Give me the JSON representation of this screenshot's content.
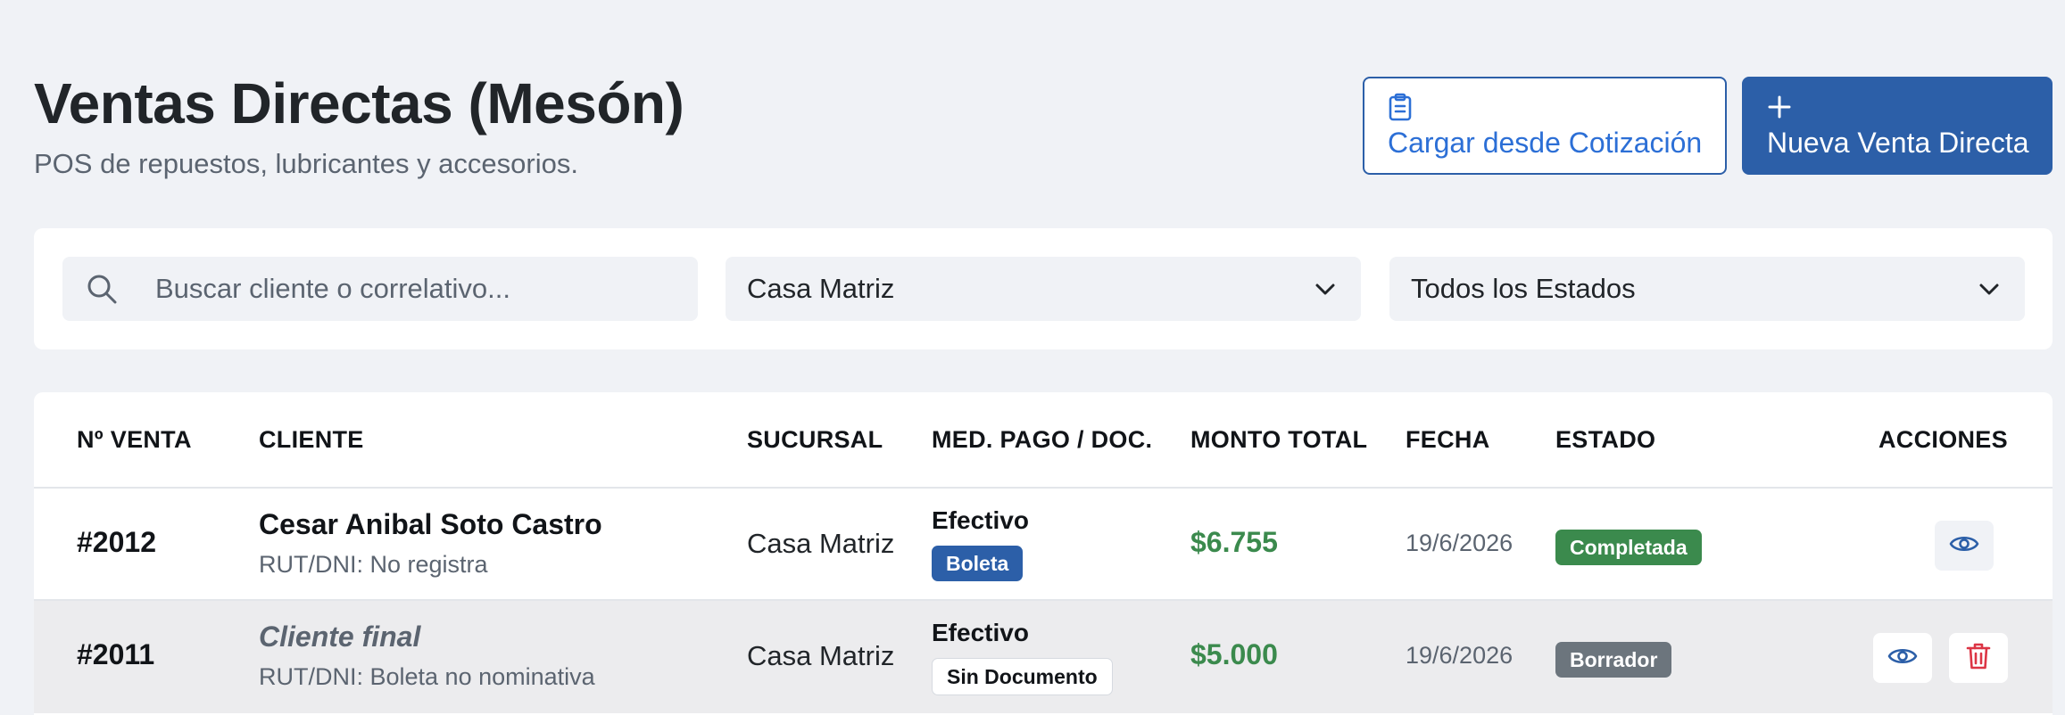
{
  "header": {
    "title": "Ventas Directas (Mesón)",
    "subtitle": "POS de repuestos, lubricantes y accesorios."
  },
  "actions": {
    "load_quote_label": "Cargar desde Cotización",
    "load_quote_icon": "clipboard-icon",
    "new_sale_label": "Nueva Venta Directa",
    "new_sale_icon": "plus-icon"
  },
  "filters": {
    "search_placeholder": "Buscar cliente o correlativo...",
    "search_value": "",
    "branch_selected": "Casa Matriz",
    "status_selected": "Todos los Estados"
  },
  "table": {
    "columns": [
      "Nº VENTA",
      "CLIENTE",
      "SUCURSAL",
      "MED. PAGO / DOC.",
      "MONTO TOTAL",
      "FECHA",
      "ESTADO",
      "ACCIONES"
    ],
    "rows": [
      {
        "number": "#2012",
        "client_name": "Cesar Anibal Soto Castro",
        "client_rut": "RUT/DNI: No registra",
        "branch": "Casa Matriz",
        "payment": "Efectivo",
        "document": "Boleta",
        "amount": "$6.755",
        "date": "19/6/2026",
        "status": "Completada"
      },
      {
        "number": "#2011",
        "client_name": "Cliente final",
        "client_rut": "RUT/DNI: Boleta no nominativa",
        "branch": "Casa Matriz",
        "payment": "Efectivo",
        "document": "Sin Documento",
        "amount": "$5.000",
        "date": "19/6/2026",
        "status": "Borrador"
      }
    ]
  },
  "colors": {
    "primary": "#2c5fa8",
    "link_blue": "#2c6fd6",
    "success": "#3b8a4d",
    "muted": "#6c757d",
    "danger": "#dc3545",
    "background": "#f0f2f6"
  }
}
